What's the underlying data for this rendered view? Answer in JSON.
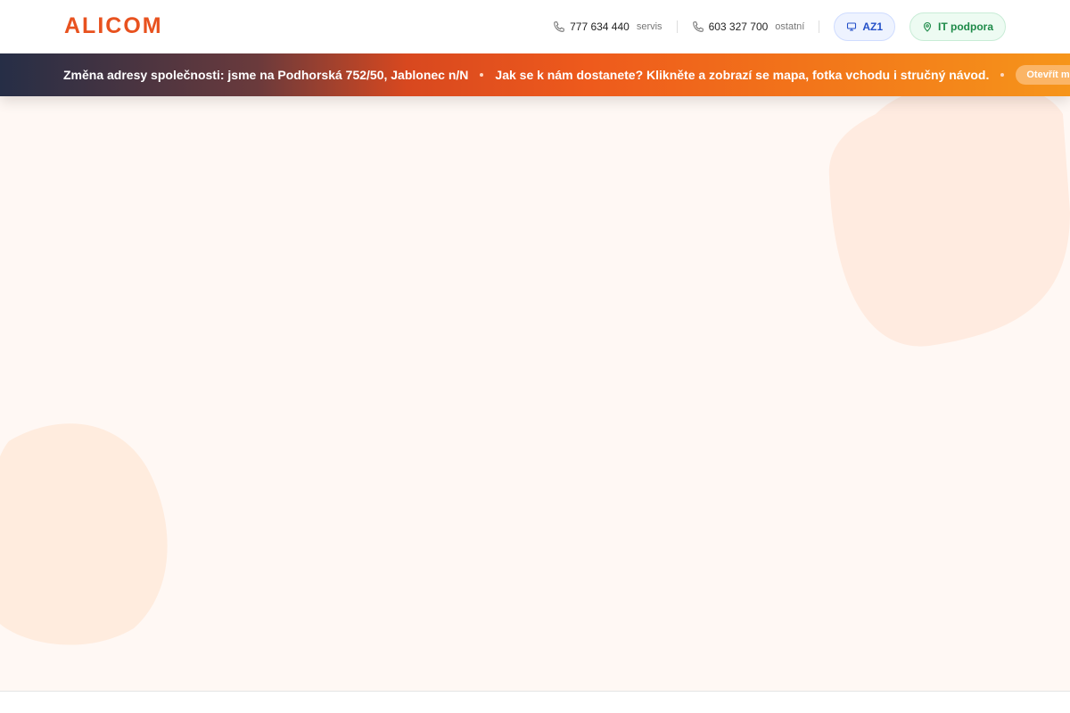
{
  "header": {
    "logo": "ALICOM",
    "phones": [
      {
        "number": "777 634 440",
        "note": "servis",
        "icon": "phone-icon"
      },
      {
        "number": "603 327 700",
        "note": "ostatní",
        "icon": "phone-icon"
      }
    ],
    "buttons": {
      "az1": {
        "label": "AZ1",
        "icon": "monitor-icon"
      },
      "it_support": {
        "label": "IT podpora",
        "icon": "location-pin-icon"
      }
    }
  },
  "ticker": {
    "items": [
      "Změna adresy společnosti: jsme na Podhorská 752/50, Jablonec n/N",
      "Jak se k nám dostanete? Klikněte a zobrazí se mapa, fotka vchodu i stručný návod."
    ],
    "button_label": "Otevřít m"
  },
  "colors": {
    "brand": "#e8521f",
    "background": "#fff8f4",
    "blob": "#ffe9dc",
    "az1_accent": "#2450c8",
    "it_support_accent": "#1d8a48"
  }
}
